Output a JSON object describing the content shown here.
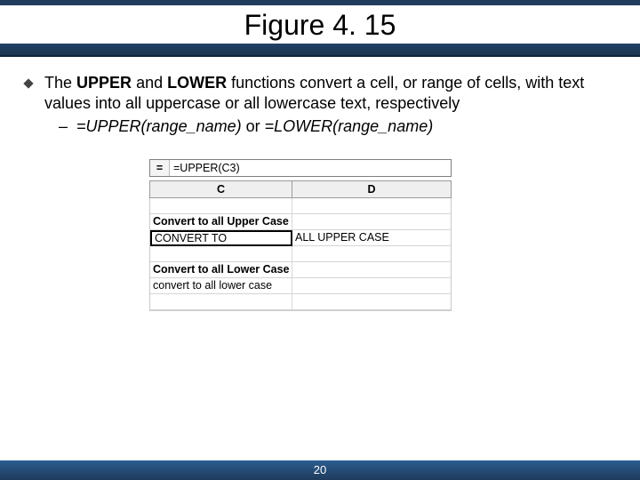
{
  "title": "Figure 4. 15",
  "bullet": {
    "pre": "The ",
    "b1": "UPPER ",
    "mid": "and ",
    "b2": "LOWER ",
    "post": "functions convert a cell, or range of cells, with text values into all uppercase or all lowercase text, respectively"
  },
  "sub": {
    "u": "=UPPER(range_name)",
    "or": "   or   ",
    "l": "=LOWER(range_name)"
  },
  "sheet": {
    "eq": "=",
    "formula": "=UPPER(C3)",
    "colC": "C",
    "colD": "D",
    "r3c": "Convert to all Upper Case",
    "r4c": "CONVERT TO",
    "r4d": "ALL UPPER CASE",
    "r6c": "Convert to all Lower Case",
    "r7c": "convert to all lower case"
  },
  "page": "20"
}
